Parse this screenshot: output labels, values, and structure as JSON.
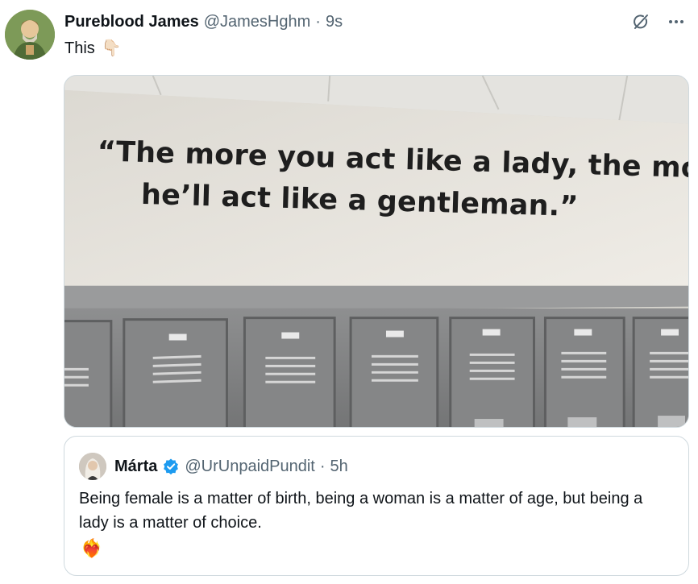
{
  "tweet": {
    "display_name": "Pureblood James",
    "handle": "@JamesHghm",
    "separator": "·",
    "time": "9s",
    "text": "This",
    "text_emoji": "👇🏻"
  },
  "header_icons": [
    "grok-icon",
    "more-icon"
  ],
  "media": {
    "quote_line_1": "“The more you act like a lady, the more",
    "quote_line_2": "he’ll act like a gentleman.”"
  },
  "quoted_tweet": {
    "display_name": "Márta",
    "handle": "@UrUnpaidPundit",
    "separator": "·",
    "time": "5h",
    "text": "Being female is a matter of birth, being a woman is a matter of age, but being a lady is a matter of choice.",
    "emoji": "❤️‍🔥"
  },
  "colors": {
    "text": "#0f1419",
    "secondary": "#536471",
    "border": "#cfd9de",
    "verified": "#1d9bf0"
  }
}
